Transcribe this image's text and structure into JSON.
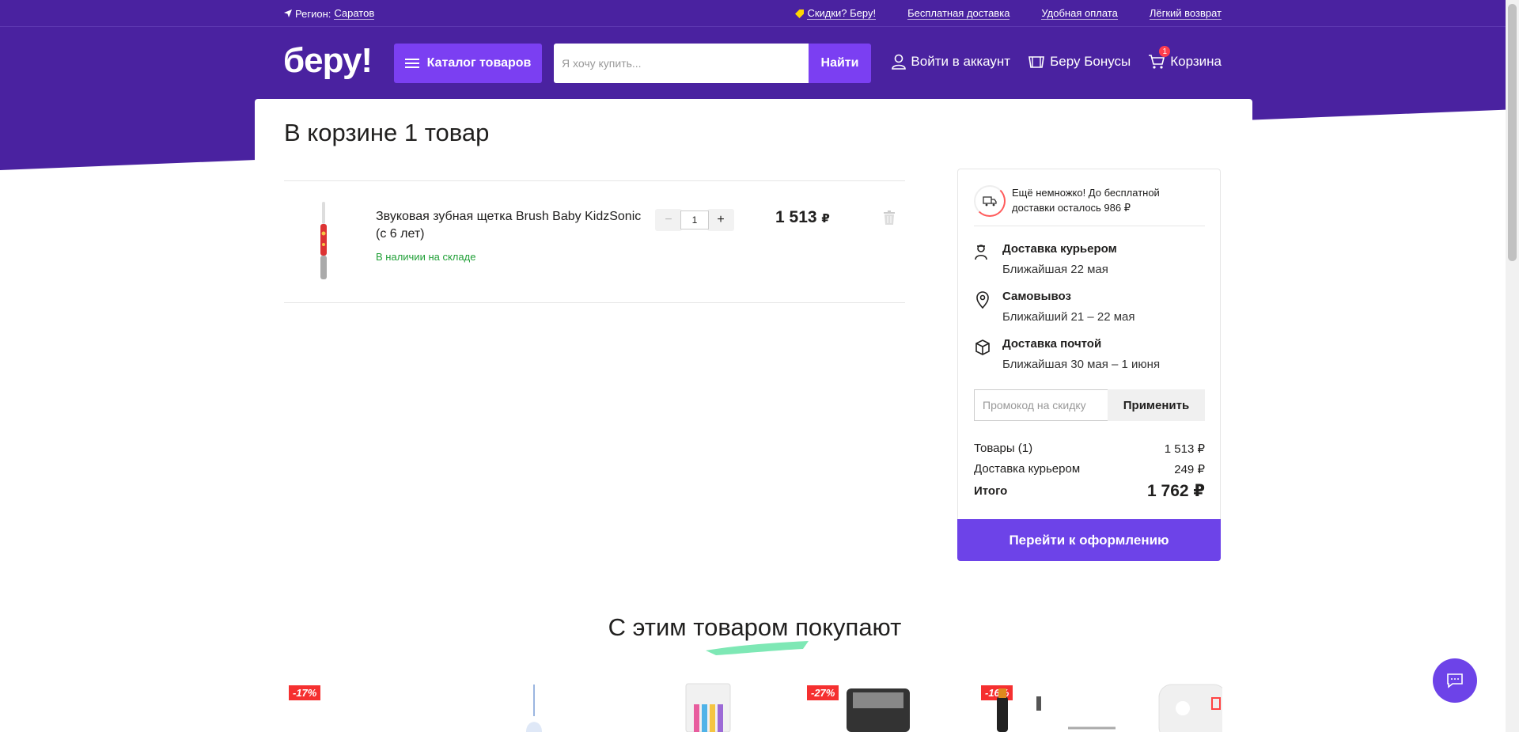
{
  "topbar": {
    "region_label": "Регион:",
    "region_value": "Саратов",
    "links": [
      "Скидки? Беру!",
      "Бесплатная доставка",
      "Удобная оплата",
      "Лёгкий возврат"
    ]
  },
  "header": {
    "logo": "беру!",
    "catalog_label": "Каталог товаров",
    "search_placeholder": "Я хочу купить...",
    "search_button": "Найти",
    "login_label": "Войти в аккаунт",
    "bonus_label": "Беру Бонусы",
    "cart_label": "Корзина",
    "cart_count": "1"
  },
  "cart": {
    "title": "В корзине 1 товар",
    "item": {
      "name": "Звуковая зубная щетка Brush Baby KidzSonic (с 6 лет)",
      "stock": "В наличии на складе",
      "quantity": "1",
      "minus": "−",
      "plus": "+",
      "price": "1 513",
      "currency": "₽"
    }
  },
  "summary": {
    "free_shipping": "Ещё немножко! До бесплатной доставки осталось 986 ₽",
    "delivery": [
      {
        "title": "Доставка курьером",
        "subtitle": "Ближайшая 22 мая",
        "icon": "courier-icon"
      },
      {
        "title": "Самовывоз",
        "subtitle": "Ближайший 21 – 22 мая",
        "icon": "location-pin-icon"
      },
      {
        "title": "Доставка почтой",
        "subtitle": "Ближайшая 30 мая – 1 июня",
        "icon": "box-icon"
      }
    ],
    "promo_placeholder": "Промокод на скидку",
    "promo_button": "Применить",
    "lines": [
      {
        "label": "Товары (1)",
        "value": "1 513 ₽"
      },
      {
        "label": "Доставка курьером",
        "value": "249 ₽"
      }
    ],
    "total_label": "Итого",
    "total_value": "1 762 ₽",
    "checkout": "Перейти к оформлению"
  },
  "recommendations": {
    "title": "С этим товаром покупают",
    "discounts": [
      "-17%",
      "-27%",
      "-16%"
    ]
  },
  "colors": {
    "brand_purple": "#4a22a0",
    "accent_purple": "#7b3ff2",
    "stock_green": "#21a038",
    "discount_red": "#f53030"
  }
}
